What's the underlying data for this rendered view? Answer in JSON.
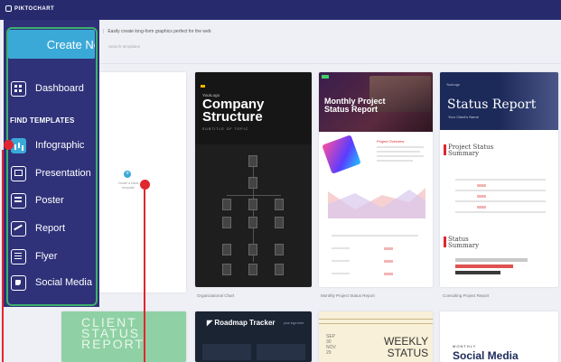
{
  "brand": {
    "name": "PIKTOCHART"
  },
  "header": {
    "subtitle": "Easily create long-form graphics perfect for the web",
    "search_hint": "Search templates"
  },
  "sidebar": {
    "create_button": "Create Ne",
    "dashboard": "Dashboard",
    "section_title": "FIND TEMPLATES",
    "items": [
      {
        "label": "Infographic",
        "icon": "infographic-icon",
        "active": true
      },
      {
        "label": "Presentation",
        "icon": "presentation-icon"
      },
      {
        "label": "Poster",
        "icon": "poster-icon"
      },
      {
        "label": "Report",
        "icon": "report-icon"
      },
      {
        "label": "Flyer",
        "icon": "flyer-icon"
      },
      {
        "label": "Social Media",
        "icon": "social-media-icon"
      }
    ]
  },
  "templates": {
    "blank": {
      "label": "Create a blank template",
      "caption": "...ion"
    },
    "company": {
      "small": "YourLogo",
      "title_line1": "Company",
      "title_line2": "Structure",
      "subtitle": "SUBTITLE OF TOPIC",
      "caption": "Organizational Chart"
    },
    "monthly": {
      "title_line1": "Monthly Project",
      "title_line2": "Status Report",
      "overview": "Project Overview",
      "caption": "Monthly Project Status Report"
    },
    "status": {
      "logo": "YourLogo",
      "title": "Status Report",
      "subtitle": "Your Client's Name",
      "h2a_line1": "Project Status",
      "h2a_line2": "Summary",
      "h2b_line1": "Status",
      "h2b_line2": "Summary",
      "caption": "Consulting Project Report"
    },
    "client": {
      "line1": "CLIENT",
      "line2": "STATUS",
      "line3": "REPORT"
    },
    "roadmap": {
      "title": "Roadmap Tracker",
      "tag": "your logo here"
    },
    "weekly": {
      "line1": "WEEKLY",
      "line2": "STATUS",
      "date1": "SEP",
      "date2": "30",
      "date3": "NOV",
      "date4": "29"
    },
    "social": {
      "small": "MONTHLY",
      "title": "Social Media"
    }
  },
  "colors": {
    "brand_navy": "#272b6e",
    "sidebar": "#2f3179",
    "accent_blue": "#3ba9d8",
    "highlight_green": "#3db06b",
    "marker_red": "#e0262f"
  }
}
